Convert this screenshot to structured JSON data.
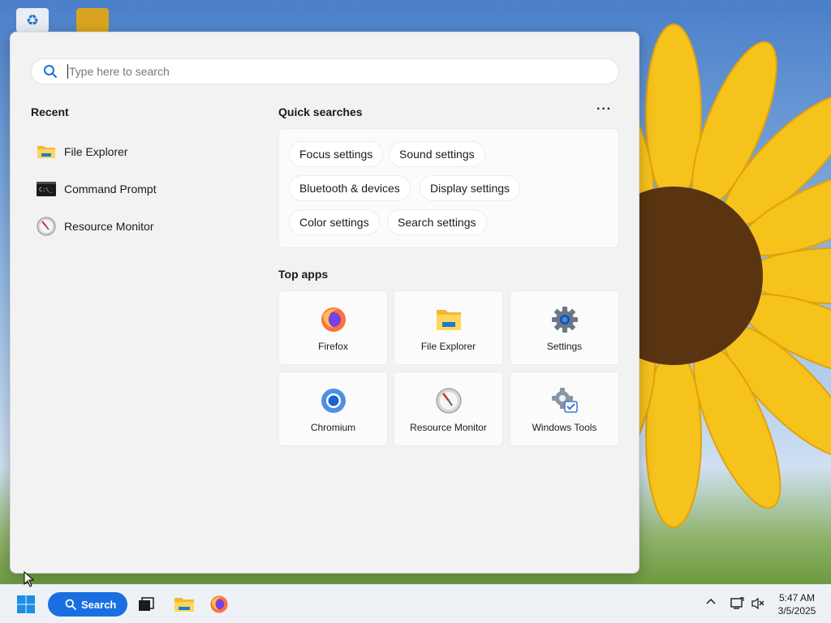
{
  "search": {
    "placeholder": "Type here to search"
  },
  "recent": {
    "title": "Recent",
    "items": [
      {
        "label": "File Explorer",
        "icon": "folder-icon"
      },
      {
        "label": "Command Prompt",
        "icon": "terminal-icon"
      },
      {
        "label": "Resource Monitor",
        "icon": "gauge-icon"
      }
    ]
  },
  "quick_searches": {
    "title": "Quick searches",
    "more_label": "···",
    "chips": [
      "Focus settings",
      "Sound settings",
      "Bluetooth & devices",
      "Display settings",
      "Color settings",
      "Search settings"
    ]
  },
  "top_apps": {
    "title": "Top apps",
    "apps": [
      {
        "label": "Firefox",
        "icon": "firefox-icon"
      },
      {
        "label": "File Explorer",
        "icon": "folder-icon"
      },
      {
        "label": "Settings",
        "icon": "gear-icon"
      },
      {
        "label": "Chromium",
        "icon": "chromium-icon"
      },
      {
        "label": "Resource Monitor",
        "icon": "gauge-icon"
      },
      {
        "label": "Windows Tools",
        "icon": "tools-icon"
      }
    ]
  },
  "taskbar": {
    "search_label": "Search",
    "time": "5:47 AM",
    "date": "3/5/2025"
  },
  "colors": {
    "accent": "#1a6fe0",
    "panel_bg": "#f2f2f2",
    "taskbar_bg": "#eef2f7"
  }
}
